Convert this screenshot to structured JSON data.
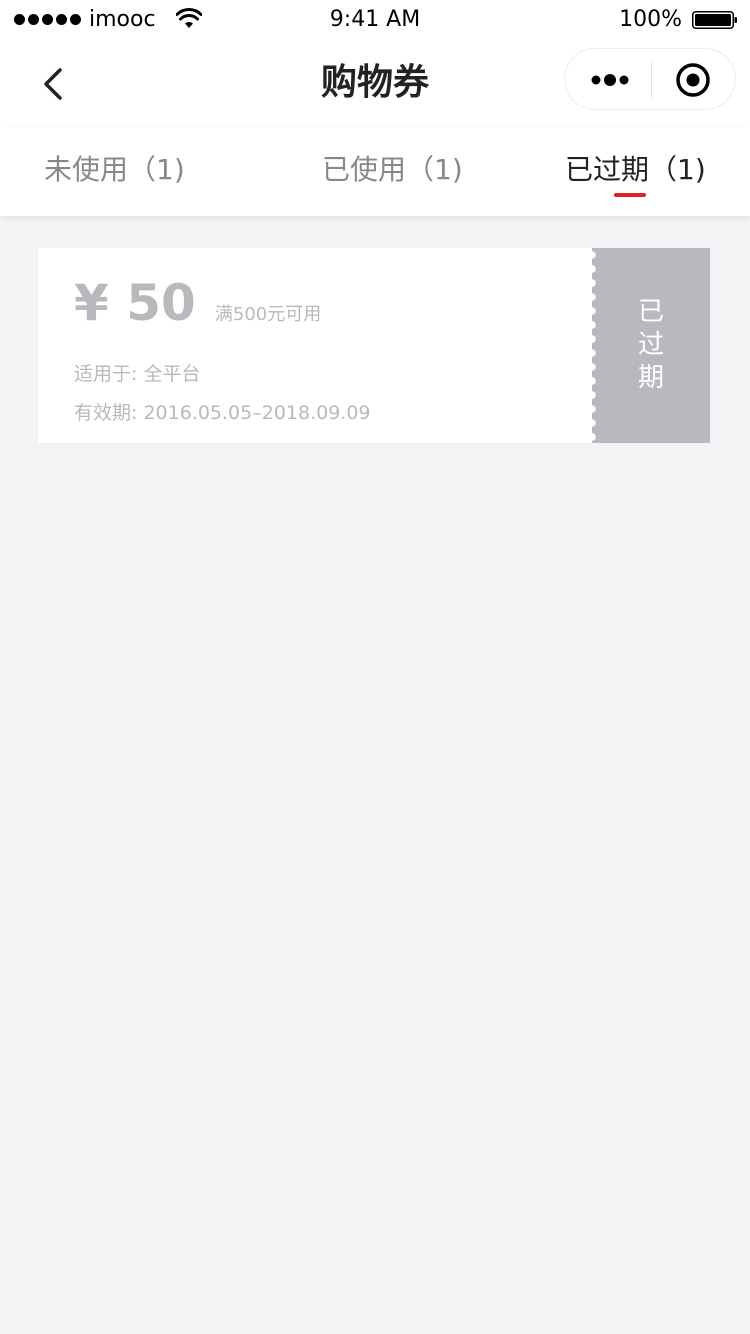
{
  "status_bar": {
    "carrier": "imooc",
    "time": "9:41 AM",
    "battery": "100%"
  },
  "nav": {
    "title": "购物券"
  },
  "tabs": [
    {
      "label": "未使用（1)",
      "active": false
    },
    {
      "label": "已使用（1)",
      "active": false
    },
    {
      "label": "已过期（1)",
      "active": true
    }
  ],
  "coupon": {
    "amount": "¥ 50",
    "condition": "满500元可用",
    "scope": "适用于: 全平台",
    "validity": "有效期:  2016.05.05–2018.09.09",
    "status": "已过期"
  },
  "colors": {
    "accent": "#e02020",
    "stub_gray": "#b8b9be",
    "background": "#f2f3f5"
  },
  "icons": [
    "signal-dots-icon",
    "wifi-icon",
    "battery-icon",
    "back-chevron-icon",
    "more-dots-icon",
    "close-target-icon"
  ]
}
